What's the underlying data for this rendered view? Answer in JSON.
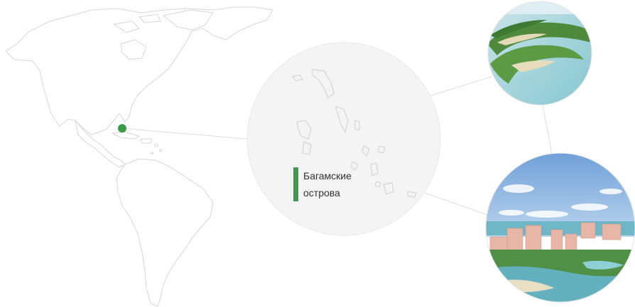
{
  "region_label": "Багамские острова",
  "colors": {
    "marker": "#3d9a4a",
    "land_stroke": "#d9d9d9",
    "connector": "#dddddd",
    "zoom_bg": "#f4f4f4"
  },
  "photos": [
    {
      "name": "aerial-island-photo",
      "subject": "island coastline"
    },
    {
      "name": "resort-photo",
      "subject": "resort towers"
    }
  ]
}
